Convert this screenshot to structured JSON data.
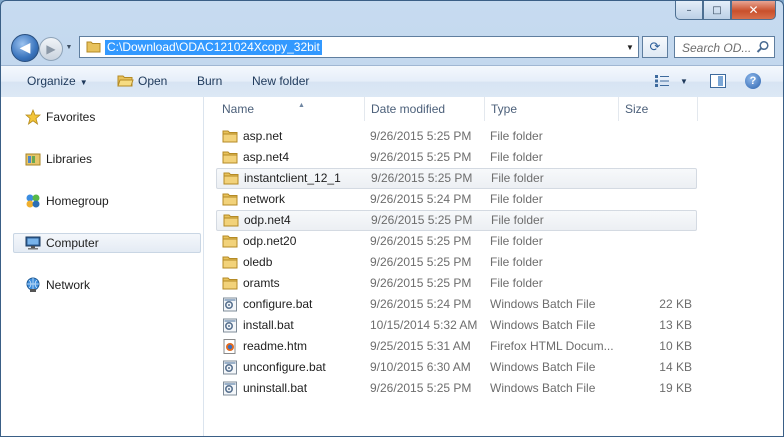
{
  "window": {
    "caption": {
      "minimize": "–",
      "maximize": "□",
      "close": "✕"
    }
  },
  "address_bar": {
    "path": "C:\\Download\\ODAC121024Xcopy_32bit"
  },
  "search": {
    "placeholder": "Search OD..."
  },
  "toolbar": {
    "organize": "Organize",
    "open": "Open",
    "burn": "Burn",
    "new_folder": "New folder"
  },
  "nav_pane": {
    "items": [
      {
        "label": "Favorites",
        "icon": "star-icon"
      },
      {
        "label": "Libraries",
        "icon": "libraries-icon"
      },
      {
        "label": "Homegroup",
        "icon": "homegroup-icon"
      },
      {
        "label": "Computer",
        "icon": "computer-icon",
        "selected": true
      },
      {
        "label": "Network",
        "icon": "network-icon"
      }
    ]
  },
  "columns": {
    "name": "Name",
    "date": "Date modified",
    "type": "Type",
    "size": "Size"
  },
  "files": [
    {
      "name": "asp.net",
      "date": "9/26/2015 5:25 PM",
      "type": "File folder",
      "size": "",
      "icon": "folder"
    },
    {
      "name": "asp.net4",
      "date": "9/26/2015 5:25 PM",
      "type": "File folder",
      "size": "",
      "icon": "folder"
    },
    {
      "name": "instantclient_12_1",
      "date": "9/26/2015 5:25 PM",
      "type": "File folder",
      "size": "",
      "icon": "folder",
      "highlight": true
    },
    {
      "name": "network",
      "date": "9/26/2015 5:24 PM",
      "type": "File folder",
      "size": "",
      "icon": "folder"
    },
    {
      "name": "odp.net4",
      "date": "9/26/2015 5:25 PM",
      "type": "File folder",
      "size": "",
      "icon": "folder",
      "highlight": true
    },
    {
      "name": "odp.net20",
      "date": "9/26/2015 5:25 PM",
      "type": "File folder",
      "size": "",
      "icon": "folder"
    },
    {
      "name": "oledb",
      "date": "9/26/2015 5:25 PM",
      "type": "File folder",
      "size": "",
      "icon": "folder"
    },
    {
      "name": "oramts",
      "date": "9/26/2015 5:25 PM",
      "type": "File folder",
      "size": "",
      "icon": "folder"
    },
    {
      "name": "configure.bat",
      "date": "9/26/2015 5:24 PM",
      "type": "Windows Batch File",
      "size": "22 KB",
      "icon": "batch"
    },
    {
      "name": "install.bat",
      "date": "10/15/2014 5:32 AM",
      "type": "Windows Batch File",
      "size": "13 KB",
      "icon": "batch"
    },
    {
      "name": "readme.htm",
      "date": "9/25/2015 5:31 AM",
      "type": "Firefox HTML Docum...",
      "size": "10 KB",
      "icon": "html"
    },
    {
      "name": "unconfigure.bat",
      "date": "9/10/2015 6:30 AM",
      "type": "Windows Batch File",
      "size": "14 KB",
      "icon": "batch"
    },
    {
      "name": "uninstall.bat",
      "date": "9/26/2015 5:25 PM",
      "type": "Windows Batch File",
      "size": "19 KB",
      "icon": "batch"
    }
  ]
}
